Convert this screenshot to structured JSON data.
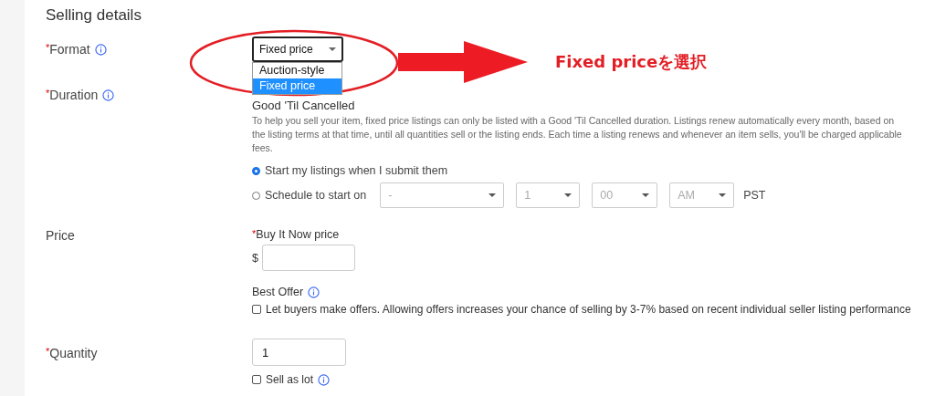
{
  "heading": "Selling details",
  "format": {
    "label": {
      "mark": "*",
      "text": "Format"
    },
    "value": "Fixed price",
    "open": true,
    "options": [
      {
        "label": "Auction-style",
        "selected": false
      },
      {
        "label": "Fixed price",
        "selected": true
      }
    ]
  },
  "duration": {
    "label": {
      "mark": "*",
      "text": "Duration"
    },
    "value": "Good 'Til Cancelled",
    "note": "To help you sell your item, fixed price listings can only be listed with a Good 'Til Cancelled duration. Listings renew automatically every month, based on the listing terms at that time, until all quantities sell or the listing ends. Each time a listing renews and whenever an item sells, you'll be charged applicable fees.",
    "start_options": [
      {
        "label": "Start my listings when I submit them",
        "selected": true
      },
      {
        "label": "Schedule to start on",
        "selected": false
      }
    ],
    "schedule": {
      "disabled": true,
      "selects": [
        "-",
        "1",
        "00",
        "AM"
      ]
    },
    "timezone": "PST"
  },
  "price": {
    "label": {
      "text": "Price"
    },
    "field_label": {
      "mark": "*",
      "text": "Buy It Now price"
    },
    "currency": "$",
    "best_offer": {
      "label": "Best Offer",
      "checked": false,
      "text": "Let buyers make offers. Allowing offers increases your chance of selling by 3-7% based on recent individual seller listing performance"
    }
  },
  "quantity": {
    "label": {
      "mark": "*",
      "text": "Quantity"
    },
    "value": "1",
    "sell_as_lot": {
      "label": "Sell as lot",
      "checked": false
    }
  },
  "annotation": {
    "text": "Fixed priceを選択"
  }
}
